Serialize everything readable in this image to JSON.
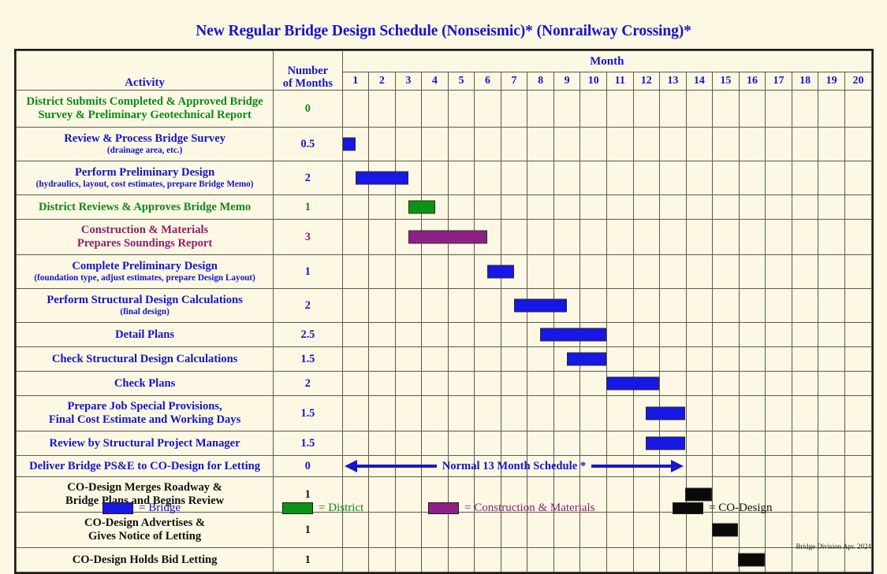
{
  "title": "New Regular Bridge Design Schedule (Nonseismic)* (Nonrailway Crossing)*",
  "colors": {
    "bridge": "#1717e6",
    "district": "#0a9416",
    "construction": "#8e2189",
    "codesign": "#0a0a0a",
    "title_text": "#1414cc",
    "background": "#fdf8e3"
  },
  "header": {
    "activity": "Activity",
    "number_of_months_line1": "Number",
    "number_of_months_line2": "of Months",
    "month": "Month",
    "month_numbers": [
      "1",
      "2",
      "3",
      "4",
      "5",
      "6",
      "7",
      "8",
      "9",
      "10",
      "11",
      "12",
      "13",
      "14",
      "15",
      "16",
      "17",
      "18",
      "19",
      "20"
    ]
  },
  "chart_data": {
    "type": "bar",
    "subtype": "gantt",
    "title": "New Regular Bridge Design Schedule (Nonseismic)* (Nonrailway Crossing)*",
    "xlabel": "Month",
    "ylabel": "Activity",
    "xlim": [
      0,
      20
    ],
    "grid": true,
    "legend_position": "bottom",
    "categories": [
      "District Submits Completed & Approved Bridge Survey & Preliminary Geotechnical Report",
      "Review & Process Bridge Survey (drainage area, etc.)",
      "Perform Preliminary Design (hydraulics, layout, cost estimates, prepare Bridge Memo)",
      "District Reviews & Approves Bridge Memo",
      "Construction & Materials Prepares Soundings Report",
      "Complete Preliminary Design (foundation type, adjust estimates, prepare Design Layout)",
      "Perform Structural Design Calculations (final design)",
      "Detail Plans",
      "Check Structural Design Calculations",
      "Check Plans",
      "Prepare Job Special Provisions, Final Cost Estimate and Working Days",
      "Review by Structural Project Manager",
      "Deliver Bridge PS&E to CO-Design for Letting",
      "CO-Design Merges Roadway & Bridge Plans and Begins Review",
      "CO-Design Advertises & Gives Notice of Letting",
      "CO-Design Holds Bid Letting"
    ],
    "durations": [
      0,
      0.5,
      2,
      1,
      3,
      1,
      2,
      2.5,
      1.5,
      2,
      1.5,
      1.5,
      0,
      1,
      1,
      1
    ],
    "starts": [
      null,
      0,
      0.5,
      2.5,
      2.5,
      5.5,
      6.5,
      7.5,
      8.5,
      10,
      11.5,
      11.5,
      null,
      13,
      14,
      15
    ],
    "ends": [
      null,
      0.5,
      2.5,
      3.5,
      5.5,
      6.5,
      8.5,
      10,
      10,
      12,
      13,
      13,
      null,
      14,
      15,
      16
    ],
    "owners": [
      "District",
      "Bridge",
      "Bridge",
      "District",
      "Construction & Materials",
      "Bridge",
      "Bridge",
      "Bridge",
      "Bridge",
      "Bridge",
      "Bridge",
      "Bridge",
      "Bridge",
      "CO-Design",
      "CO-Design",
      "CO-Design"
    ],
    "annotation": {
      "text": "Normal 13 Month Schedule *",
      "start": 0,
      "end": 13
    }
  },
  "rows": [
    {
      "activity": "District Submits Completed & Approved Bridge",
      "activity_line2": "Survey & Preliminary Geotechnical Report",
      "sub": "",
      "months": "0",
      "color": "green",
      "bar": null
    },
    {
      "activity": "Review & Process Bridge Survey",
      "activity_line2": "",
      "sub": "(drainage area, etc.)",
      "months": "0.5",
      "color": "blue",
      "bar": {
        "start": 0,
        "end": 0.5,
        "fill": "blue"
      }
    },
    {
      "activity": "Perform Preliminary Design",
      "activity_line2": "",
      "sub": "(hydraulics, layout, cost estimates, prepare Bridge Memo)",
      "months": "2",
      "color": "blue",
      "bar": {
        "start": 0.5,
        "end": 2.5,
        "fill": "blue"
      }
    },
    {
      "activity": "District Reviews & Approves Bridge Memo",
      "activity_line2": "",
      "sub": "",
      "months": "1",
      "color": "green",
      "bar": {
        "start": 2.5,
        "end": 3.5,
        "fill": "green"
      }
    },
    {
      "activity": "Construction & Materials",
      "activity_line2": "Prepares Soundings Report",
      "sub": "",
      "months": "3",
      "color": "purple",
      "bar": {
        "start": 2.5,
        "end": 5.5,
        "fill": "purple"
      }
    },
    {
      "activity": "Complete Preliminary Design",
      "activity_line2": "",
      "sub": "(foundation type, adjust estimates, prepare Design Layout)",
      "months": "1",
      "color": "blue",
      "bar": {
        "start": 5.5,
        "end": 6.5,
        "fill": "blue"
      }
    },
    {
      "activity": "Perform Structural Design Calculations",
      "activity_line2": "",
      "sub": "(final design)",
      "months": "2",
      "color": "blue",
      "bar": {
        "start": 6.5,
        "end": 8.5,
        "fill": "blue"
      }
    },
    {
      "activity": "Detail Plans",
      "activity_line2": "",
      "sub": "",
      "months": "2.5",
      "color": "blue",
      "bar": {
        "start": 7.5,
        "end": 10,
        "fill": "blue"
      }
    },
    {
      "activity": "Check Structural Design Calculations",
      "activity_line2": "",
      "sub": "",
      "months": "1.5",
      "color": "blue",
      "bar": {
        "start": 8.5,
        "end": 10,
        "fill": "blue"
      }
    },
    {
      "activity": "Check Plans",
      "activity_line2": "",
      "sub": "",
      "months": "2",
      "color": "blue",
      "bar": {
        "start": 10,
        "end": 12,
        "fill": "blue"
      }
    },
    {
      "activity": "Prepare Job Special Provisions,",
      "activity_line2": "Final Cost Estimate and Working Days",
      "sub": "",
      "months": "1.5",
      "color": "blue",
      "bar": {
        "start": 11.5,
        "end": 13,
        "fill": "blue"
      }
    },
    {
      "activity": "Review by Structural Project Manager",
      "activity_line2": "",
      "sub": "",
      "months": "1.5",
      "color": "blue",
      "bar": {
        "start": 11.5,
        "end": 13,
        "fill": "blue"
      }
    },
    {
      "activity": "Deliver Bridge PS&E to CO-Design for Letting",
      "activity_line2": "",
      "sub": "",
      "months": "0",
      "color": "blue",
      "bar": null,
      "arrow": {
        "start": 0,
        "end": 13,
        "label": "Normal 13 Month Schedule *"
      }
    },
    {
      "activity": "CO-Design Merges Roadway &",
      "activity_line2": "Bridge Plans and Begins Review",
      "sub": "",
      "months": "1",
      "color": "black",
      "bar": {
        "start": 13,
        "end": 14,
        "fill": "black"
      }
    },
    {
      "activity": "CO-Design Advertises &",
      "activity_line2": "Gives Notice of Letting",
      "sub": "",
      "months": "1",
      "color": "black",
      "bar": {
        "start": 14,
        "end": 15,
        "fill": "black"
      }
    },
    {
      "activity": "CO-Design Holds Bid Letting",
      "activity_line2": "",
      "sub": "",
      "months": "1",
      "color": "black",
      "bar": {
        "start": 15,
        "end": 16,
        "fill": "black"
      }
    }
  ],
  "legend": [
    {
      "label": "= Bridge",
      "fill": "blue",
      "text_color": "#1414cc"
    },
    {
      "label": "= District",
      "fill": "green",
      "text_color": "#0a8a18"
    },
    {
      "label": "= Construction & Materials",
      "fill": "purple",
      "text_color": "#8e2070"
    },
    {
      "label": "= CO-Design",
      "fill": "black",
      "text_color": "#111111"
    }
  ],
  "footer": "Bridge Division Apr. 2024"
}
